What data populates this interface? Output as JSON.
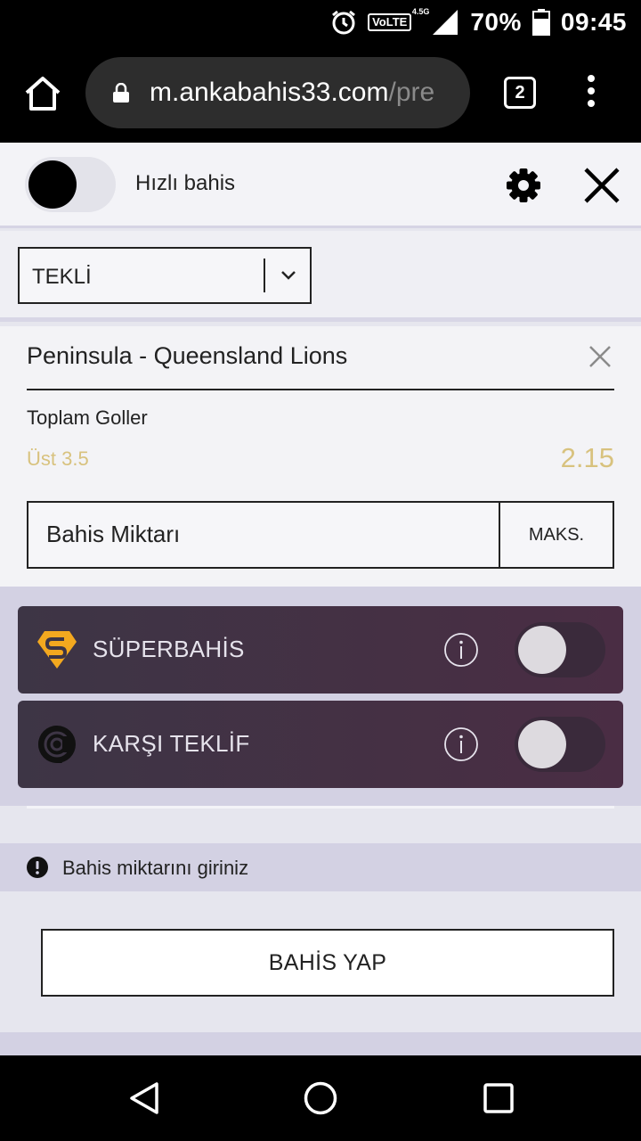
{
  "status_bar": {
    "network": "VoLTE",
    "network_sup": "4.5G",
    "battery": "70%",
    "time": "09:45",
    "icons": [
      "alarm-icon",
      "signal-icon",
      "battery-icon"
    ]
  },
  "browser": {
    "url_host": "m.ankabahis33.com",
    "url_rest": "/pre",
    "tab_count": "2",
    "icons": [
      "home-icon",
      "lock-icon",
      "overflow-menu-icon"
    ]
  },
  "betslip": {
    "quick_bet_label": "Hızlı bahis",
    "quick_bet_on": true,
    "bet_type": "TEKLİ",
    "bet": {
      "match": "Peninsula - Queensland Lions",
      "market": "Toplam Goller",
      "selection": "Üst 3.5",
      "odds": "2.15"
    },
    "stake_placeholder": "Bahis Miktarı",
    "max_label": "MAKS.",
    "promos": [
      {
        "label": "SÜPERBAHİS",
        "enabled": false
      },
      {
        "label": "KARŞI TEKLİF",
        "enabled": false
      }
    ],
    "warning": "Bahis miktarını giriniz",
    "place_bet_label": "BAHİS YAP"
  },
  "colors": {
    "accent_gold": "#d8c27e",
    "promo_bg": "#4a2d44",
    "panel_bg": "#d3d1e3"
  }
}
